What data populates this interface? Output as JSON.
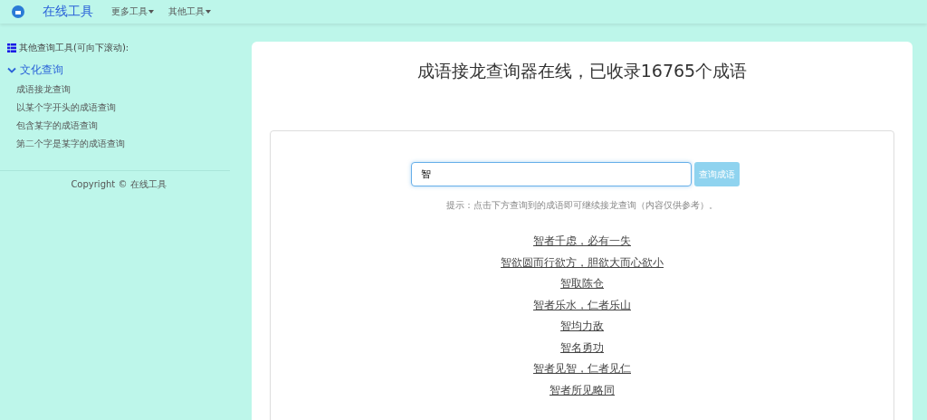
{
  "navbar": {
    "brand": "在线工具",
    "menus": [
      {
        "label": "更多工具"
      },
      {
        "label": "其他工具"
      }
    ]
  },
  "sidebar": {
    "heading": "其他查询工具(可向下滚动):",
    "group": {
      "label": "文化查询",
      "expanded": true,
      "items": [
        {
          "label": "成语接龙查询"
        },
        {
          "label": "以某个字开头的成语查询"
        },
        {
          "label": "包含某字的成语查询"
        },
        {
          "label": "第二个字是某字的成语查询"
        }
      ]
    },
    "copyright": "Copyright © 在线工具"
  },
  "main": {
    "title": "成语接龙查询器在线，已收录16765个成语",
    "search": {
      "value": "智",
      "button": "查询成语"
    },
    "hint": "提示：点击下方查询到的成语即可继续接龙查询（内容仅供参考）。",
    "results": [
      "智者千虑，必有一失",
      "智欲圆而行欲方，胆欲大而心欲小",
      "智取陈仓",
      "智者乐水，仁者乐山",
      "智均力敌",
      "智名勇功",
      "智者见智，仁者见仁",
      "智者所见略同"
    ]
  }
}
